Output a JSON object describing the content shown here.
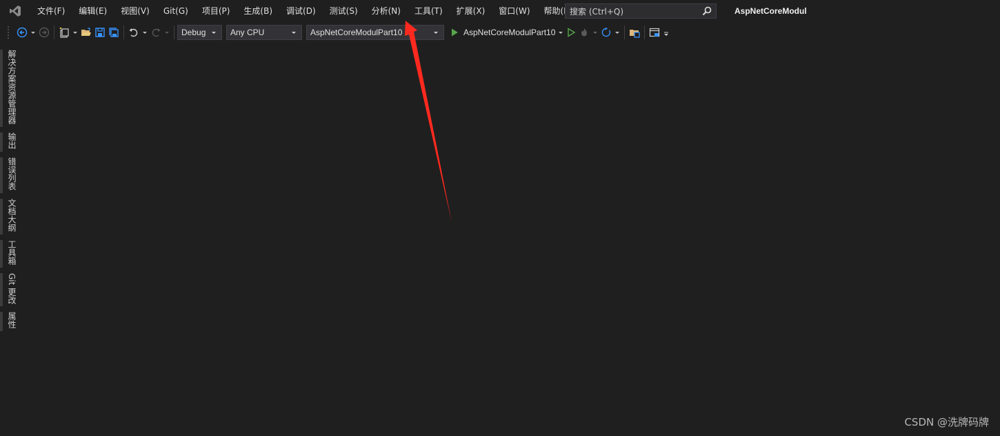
{
  "menubar": {
    "logo_icon": "visual-studio-logo-icon",
    "items": [
      "文件(F)",
      "编辑(E)",
      "视图(V)",
      "Git(G)",
      "项目(P)",
      "生成(B)",
      "调试(D)",
      "测试(S)",
      "分析(N)",
      "工具(T)",
      "扩展(X)",
      "窗口(W)",
      "帮助(H)"
    ],
    "search_placeholder": "搜索 (Ctrl+Q)",
    "search_icon": "search-icon",
    "app_title": "AspNetCoreModul"
  },
  "toolbar": {
    "config": "Debug",
    "platform": "Any CPU",
    "startup_project": "AspNetCoreModulPart10",
    "run_target": "AspNetCoreModulPart10",
    "icons": [
      "back-icon",
      "forward-icon",
      "new-project-icon",
      "open-file-icon",
      "save-icon",
      "save-all-icon",
      "undo-icon",
      "redo-icon",
      "start-icon",
      "start-without-debugging-icon",
      "hot-reload-icon",
      "refresh-icon",
      "solution-explorer-icon",
      "window-layout-icon"
    ]
  },
  "sidebar": {
    "tabs": [
      "解决方案资源管理器",
      "输出",
      "错误列表",
      "文档大纲",
      "工具箱",
      "Git 更改",
      "属性"
    ]
  },
  "colors": {
    "background": "#1f1f1f",
    "accent_blue": "#3794ff",
    "run_green": "#57a64a",
    "annotation_red": "#ff2a1f"
  },
  "watermark": "CSDN @洗牌码牌"
}
